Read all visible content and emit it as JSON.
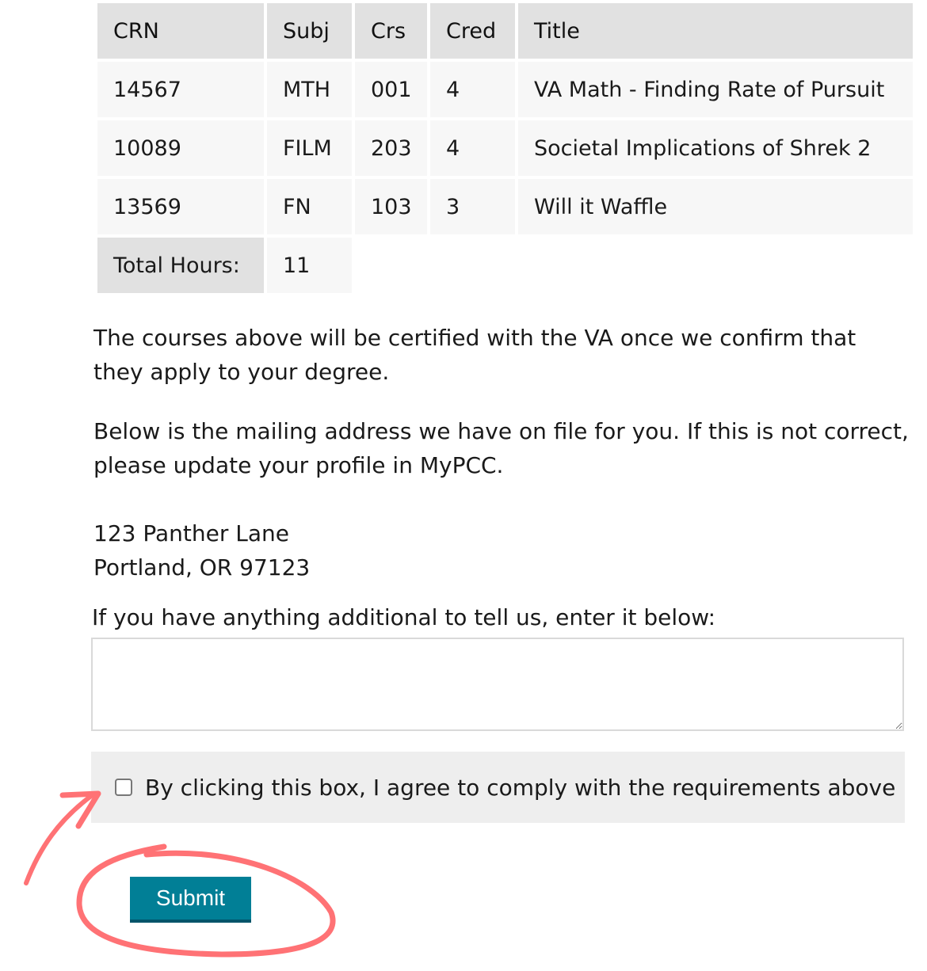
{
  "table": {
    "headers": [
      "CRN",
      "Subj",
      "Crs",
      "Cred",
      "Title"
    ],
    "rows": [
      {
        "crn": "14567",
        "subj": "MTH",
        "crs": "001",
        "cred": "4",
        "title": "VA Math - Finding Rate of Pursuit"
      },
      {
        "crn": "10089",
        "subj": "FILM",
        "crs": "203",
        "cred": "4",
        "title": "Societal Implications of Shrek 2"
      },
      {
        "crn": "13569",
        "subj": "FN",
        "crs": "103",
        "cred": "3",
        "title": "Will it Waffle"
      }
    ],
    "total_label": "Total Hours:",
    "total_value": "11"
  },
  "text": {
    "certify_note": "The courses above will be certified with the VA once we confirm that they apply to your degree.",
    "address_note": "Below is the mailing address we have on file for you. If this is not correct, please update your profile in MyPCC.",
    "address_line1": "123 Panther Lane",
    "address_line2": "Portland, OR 97123",
    "notes_label": "If you have anything additional to tell us, enter it below:"
  },
  "form": {
    "notes_value": "",
    "agree_label": "By clicking this box, I agree to comply with the requirements above",
    "agree_checked": false,
    "submit_label": "Submit"
  },
  "annotations": {
    "color": "#ff7275",
    "items": [
      "arrow pointing to agree checkbox",
      "circle around submit button"
    ]
  }
}
